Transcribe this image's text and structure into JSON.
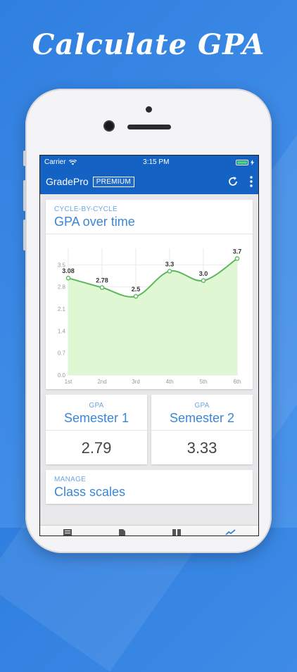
{
  "headline": "Calculate GPA",
  "status": {
    "carrier": "Carrier",
    "time": "3:15 PM"
  },
  "app": {
    "name": "GradePro",
    "badge": "PREMIUM"
  },
  "gpa_card": {
    "overline": "CYCLE-BY-CYCLE",
    "title": "GPA over time"
  },
  "chart_data": {
    "type": "area",
    "categories": [
      "1st",
      "2nd",
      "3rd",
      "4th",
      "5th",
      "6th"
    ],
    "values": [
      3.08,
      2.78,
      2.5,
      3.3,
      3.0,
      3.7
    ],
    "value_labels": [
      "3.08",
      "2.78",
      "2.5",
      "3.3",
      "3.0",
      "3.7"
    ],
    "yticks": [
      "0.0",
      "0.7",
      "1.4",
      "2.1",
      "2.8",
      "3.5"
    ],
    "ylim": [
      0,
      3.8
    ],
    "grid": true,
    "colors": {
      "line": "#5cb85c",
      "fill": "#dff7d3",
      "grid": "#e9e9e9"
    }
  },
  "semesters": [
    {
      "overline": "GPA",
      "title": "Semester 1",
      "value": "2.79"
    },
    {
      "overline": "GPA",
      "title": "Semester 2",
      "value": "3.33"
    }
  ],
  "manage_card": {
    "overline": "MANAGE",
    "title": "Class scales"
  },
  "colors": {
    "appbar": "#1463c4",
    "accent": "#3a86d6",
    "background": "#2f7fe0"
  },
  "icons": [
    "wifi-icon",
    "battery-icon",
    "refresh-icon",
    "more-vert-icon",
    "tab-list-icon",
    "tab-document-icon",
    "tab-book-icon",
    "tab-chart-icon"
  ]
}
